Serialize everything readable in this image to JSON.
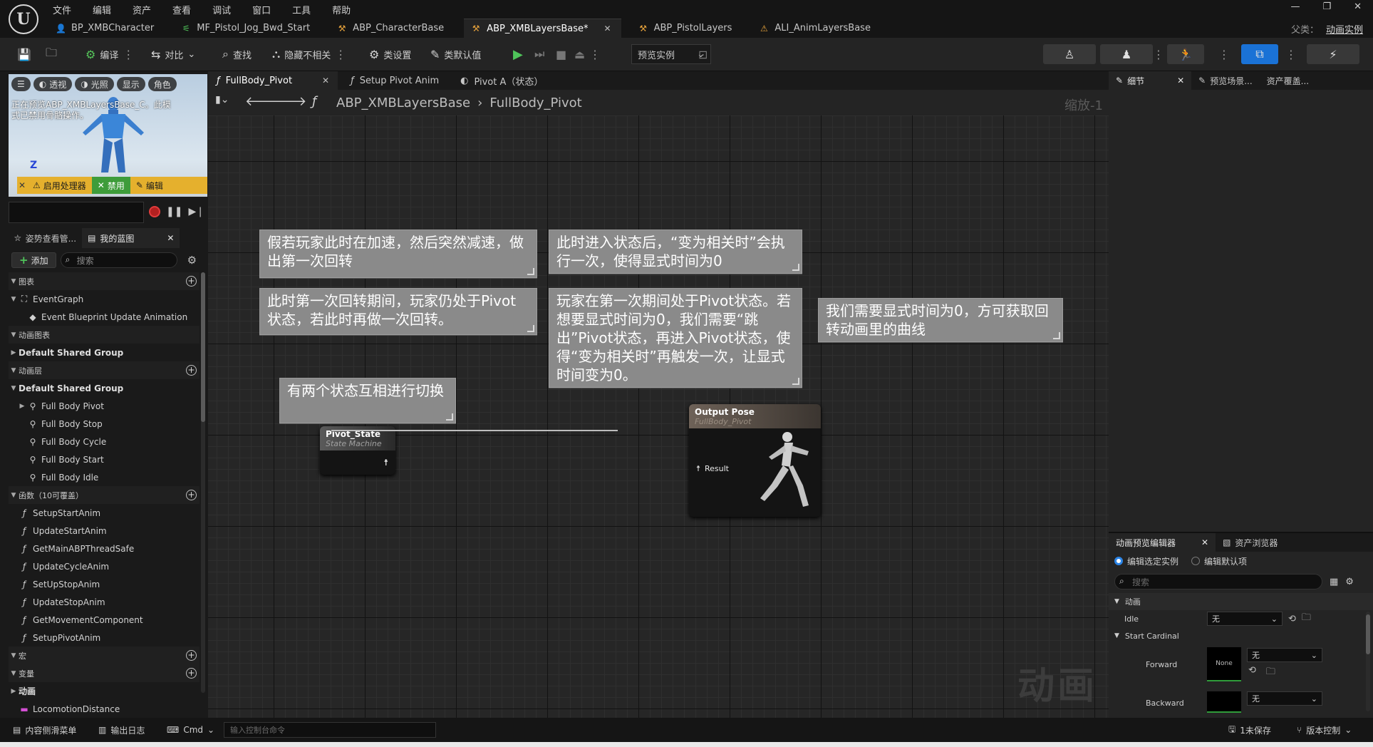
{
  "menu": [
    "文件",
    "编辑",
    "资产",
    "查看",
    "调试",
    "窗口",
    "工具",
    "帮助"
  ],
  "doc_tabs": [
    {
      "label": "BP_XMBCharacter",
      "icon": "person-icon"
    },
    {
      "label": "MF_Pistol_Jog_Bwd_Start",
      "icon": "anim-sequence-icon"
    },
    {
      "label": "ABP_CharacterBase",
      "icon": "anim-blueprint-icon"
    },
    {
      "label": "ABP_XMBLayersBase*",
      "icon": "anim-blueprint-icon",
      "active": true
    },
    {
      "label": "ABP_PistolLayers",
      "icon": "anim-blueprint-icon"
    },
    {
      "label": "ALI_AnimLayersBase",
      "icon": "anim-interface-icon"
    }
  ],
  "parent_class": {
    "label": "父类：",
    "value": "动画实例"
  },
  "toolbar": {
    "compile": "编译",
    "diff": "对比",
    "find": "查找",
    "hide_unrelated": "隐藏不相关",
    "class_settings": "类设置",
    "class_defaults": "类默认值",
    "preview_instance": "预览实例"
  },
  "viewport": {
    "pills": [
      "透视",
      "光照",
      "显示",
      "角色"
    ],
    "message": "正在预览ABP_XMBLayersBase_C。此模式已禁用骨骼操作。",
    "axis": "Z",
    "warn_items": [
      "启用处理器",
      "禁用",
      "编辑"
    ]
  },
  "left_tabs": [
    "姿势查看管...",
    "我的蓝图"
  ],
  "left_panel": {
    "add": "添加",
    "search_placeholder": "搜索",
    "tree": [
      {
        "type": "cat",
        "label": "图表",
        "plus": true
      },
      {
        "type": "item",
        "label": "EventGraph",
        "indent": 0,
        "icon": "graph-icon",
        "arrow": "down"
      },
      {
        "type": "item",
        "label": "Event Blueprint Update Animation",
        "indent": 1,
        "icon": "event-icon"
      },
      {
        "type": "cat",
        "label": "动画图表",
        "plus": false
      },
      {
        "type": "grp",
        "label": "Default Shared Group",
        "arrow": "right"
      },
      {
        "type": "cat",
        "label": "动画层",
        "plus": true
      },
      {
        "type": "grp",
        "label": "Default Shared Group",
        "arrow": "down"
      },
      {
        "type": "item",
        "label": "Full Body Pivot",
        "indent": 1,
        "icon": "anim-layer-icon",
        "arrow": "right"
      },
      {
        "type": "item",
        "label": "Full Body Stop",
        "indent": 1,
        "icon": "anim-layer-icon"
      },
      {
        "type": "item",
        "label": "Full Body Cycle",
        "indent": 1,
        "icon": "anim-layer-icon"
      },
      {
        "type": "item",
        "label": "Full Body Start",
        "indent": 1,
        "icon": "anim-layer-icon"
      },
      {
        "type": "item",
        "label": "Full Body Idle",
        "indent": 1,
        "icon": "anim-layer-icon"
      },
      {
        "type": "cat",
        "label": "函数（10可覆盖）",
        "plus": true
      },
      {
        "type": "item",
        "label": "SetupStartAnim",
        "indent": 0,
        "icon": "function-icon"
      },
      {
        "type": "item",
        "label": "UpdateStartAnim",
        "indent": 0,
        "icon": "function-icon"
      },
      {
        "type": "item",
        "label": "GetMainABPThreadSafe",
        "indent": 0,
        "icon": "function-icon"
      },
      {
        "type": "item",
        "label": "UpdateCycleAnim",
        "indent": 0,
        "icon": "function-icon"
      },
      {
        "type": "item",
        "label": "SetUpStopAnim",
        "indent": 0,
        "icon": "function-icon"
      },
      {
        "type": "item",
        "label": "UpdateStopAnim",
        "indent": 0,
        "icon": "function-icon"
      },
      {
        "type": "item",
        "label": "GetMovementComponent",
        "indent": 0,
        "icon": "function-icon"
      },
      {
        "type": "item",
        "label": "SetupPivotAnim",
        "indent": 0,
        "icon": "function-icon"
      },
      {
        "type": "cat",
        "label": "宏",
        "plus": true
      },
      {
        "type": "cat",
        "label": "变量",
        "plus": true
      },
      {
        "type": "grp",
        "label": "动画",
        "arrow": "right"
      },
      {
        "type": "item",
        "label": "LocomotionDistance",
        "indent": 0,
        "icon": "variable-icon"
      }
    ]
  },
  "graph_tabs": [
    {
      "label": "FullBody_Pivot",
      "active": true,
      "closable": true,
      "icon": "function-icon"
    },
    {
      "label": "Setup Pivot Anim",
      "icon": "function-icon"
    },
    {
      "label": "Pivot A（状态）",
      "icon": "state-icon"
    }
  ],
  "breadcrumb": [
    "ABP_XMBLayersBase",
    "FullBody_Pivot"
  ],
  "zoom": "缩放-1",
  "comments": [
    "假若玩家此时在加速，然后突然减速，做出第一次回转",
    "此时进入状态后，“变为相关时”会执行一次，使得显式时间为0",
    "此时第一次回转期间，玩家仍处于Pivot状态，若此时再做一次回转。",
    "玩家在第一次期间处于Pivot状态。若想要显式时间为0，我们需要“跳出”Pivot状态，再进入Pivot状态，使得“变为相关时”再触发一次，让显式时间变为0。",
    "我们需要显式时间为0，方可获取回转动画里的曲线",
    "有两个状态互相进行切换"
  ],
  "nodes": {
    "pivot_state": {
      "title": "Pivot_State",
      "subtitle": "State Machine"
    },
    "output_pose": {
      "title": "Output Pose",
      "subtitle": "FullBody_Pivot",
      "pin": "Result"
    }
  },
  "graph_watermark": "动画",
  "right_tabs": [
    "细节",
    "预览场景...",
    "资产覆盖..."
  ],
  "ape": {
    "tabs": [
      "动画预览编辑器",
      "资产浏览器"
    ],
    "radio_selected": "编辑选定实例",
    "radio_default": "编辑默认项",
    "search_placeholder": "搜索",
    "cat_anim": "动画",
    "idle_label": "Idle",
    "none": "无",
    "start_cardinal": "Start Cardinal",
    "forward": "Forward",
    "backward": "Backward",
    "thumb_none": "None"
  },
  "status": {
    "content_drawer": "内容侧滑菜单",
    "output_log": "输出日志",
    "cmd": "Cmd",
    "cmd_placeholder": "输入控制台命令",
    "unsaved": "1未保存",
    "source_control": "版本控制"
  }
}
